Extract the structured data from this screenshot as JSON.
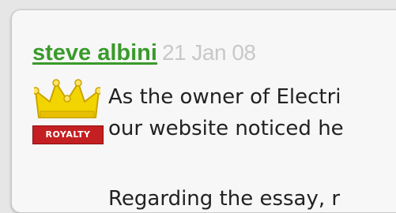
{
  "comment": {
    "author": "steve albini",
    "date": "21 Jan 08",
    "badge_label": "ROYALTY",
    "body_lines": [
      "As the owner of Electri",
      "our website noticed he"
    ],
    "para2": "Regarding the essay, r"
  },
  "colors": {
    "author_link": "#3a9a2c",
    "date": "#c8c8c8",
    "badge": "#c41f22",
    "crown": "#f2d400"
  },
  "icons": {
    "crown": "crown-icon"
  }
}
